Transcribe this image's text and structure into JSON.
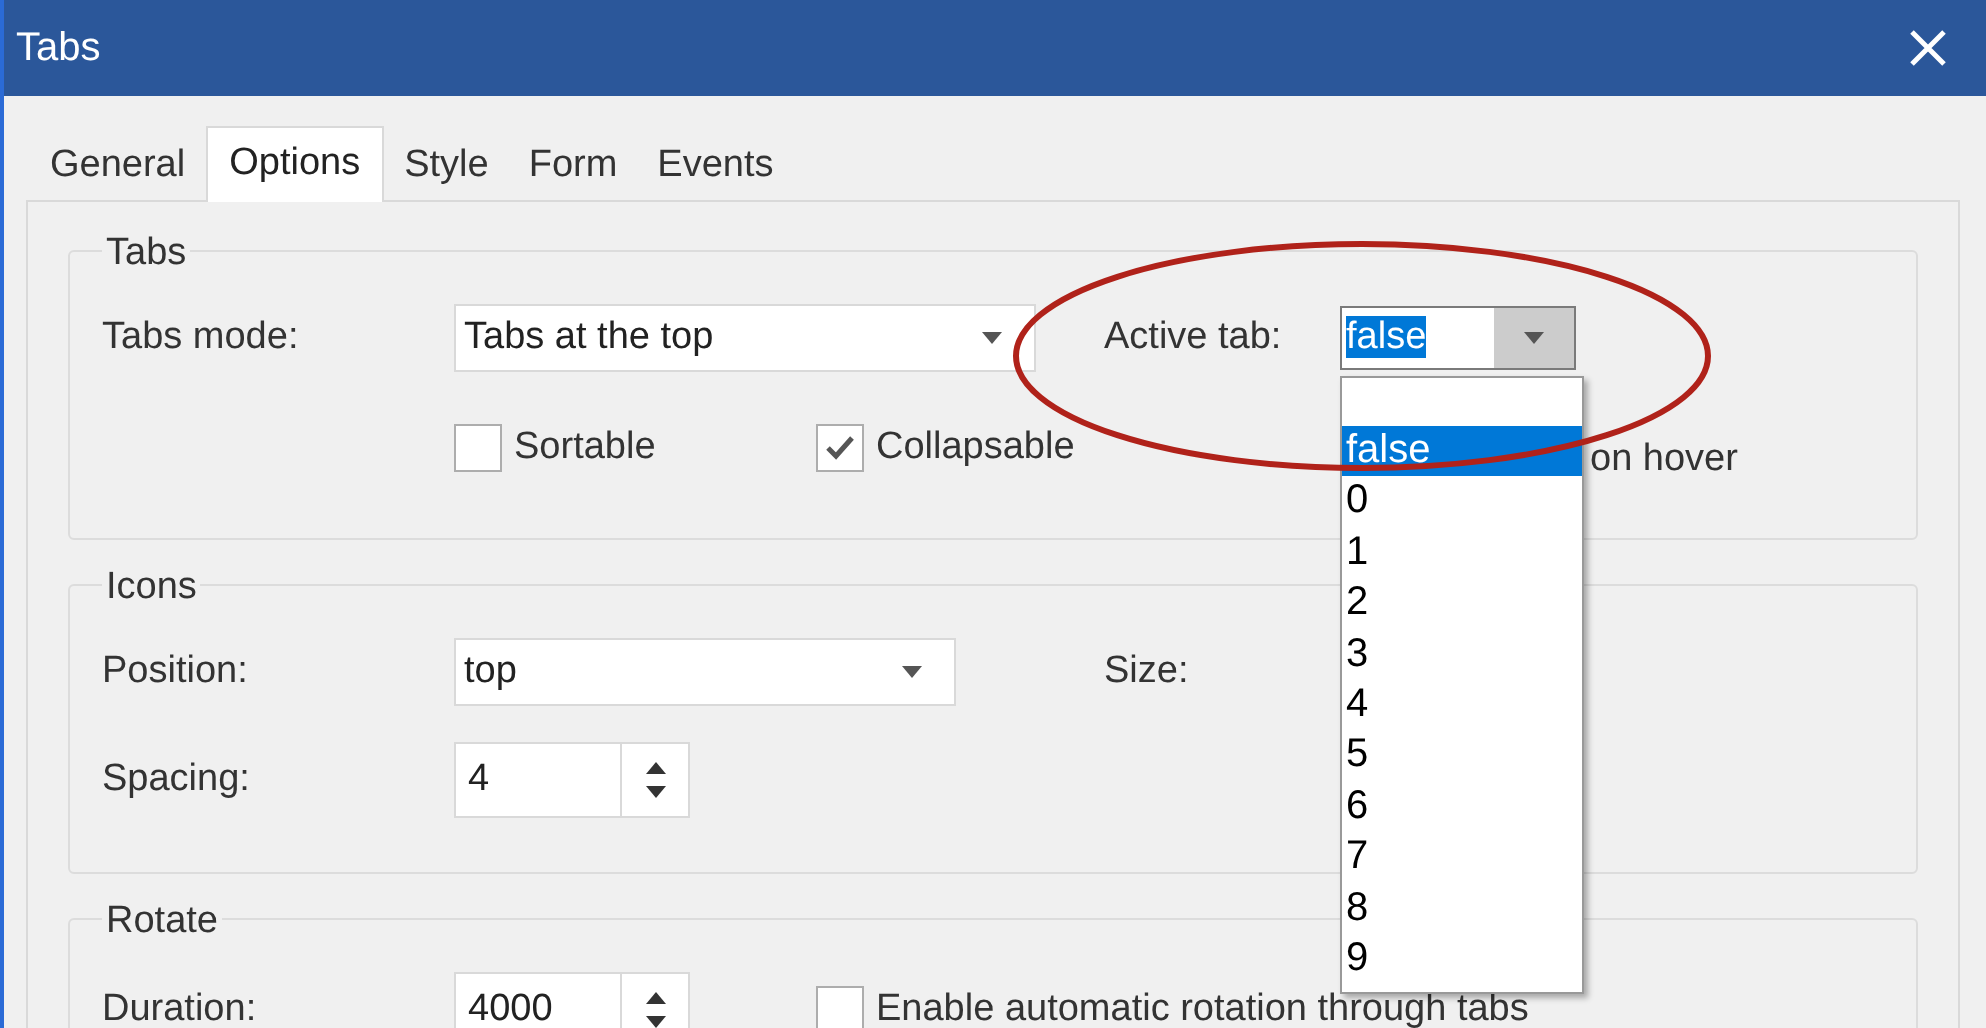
{
  "window": {
    "title": "Tabs"
  },
  "tabs": [
    {
      "label": "General",
      "selected": false
    },
    {
      "label": "Options",
      "selected": true
    },
    {
      "label": "Style",
      "selected": false
    },
    {
      "label": "Form",
      "selected": false
    },
    {
      "label": "Events",
      "selected": false
    }
  ],
  "tabs_group": {
    "title": "Tabs",
    "tabs_mode": {
      "label": "Tabs mode:",
      "value": "Tabs at the top"
    },
    "active_tab": {
      "label": "Active tab:",
      "value": "false",
      "expanded": true,
      "options": [
        {
          "label": "false",
          "selected": true
        },
        {
          "label": "0",
          "selected": false
        },
        {
          "label": "1",
          "selected": false
        },
        {
          "label": "2",
          "selected": false
        },
        {
          "label": "3",
          "selected": false
        },
        {
          "label": "4",
          "selected": false
        },
        {
          "label": "5",
          "selected": false
        },
        {
          "label": "6",
          "selected": false
        },
        {
          "label": "7",
          "selected": false
        },
        {
          "label": "8",
          "selected": false
        },
        {
          "label": "9",
          "selected": false
        }
      ]
    },
    "checkboxes": [
      {
        "label": "Sortable",
        "checked": false
      },
      {
        "label": "Collapsable",
        "checked": true
      }
    ],
    "partly_hidden_option": {
      "label": "on hover"
    }
  },
  "icons_group": {
    "title": "Icons",
    "position": {
      "label": "Position:",
      "value": "top"
    },
    "size": {
      "label": "Size:"
    },
    "spacing": {
      "label": "Spacing:",
      "value": "4"
    }
  },
  "rotate_group": {
    "title": "Rotate",
    "duration": {
      "label": "Duration:",
      "value": "4000"
    },
    "rotation": {
      "label": "Enable automatic rotation through tabs",
      "checked": false
    }
  }
}
